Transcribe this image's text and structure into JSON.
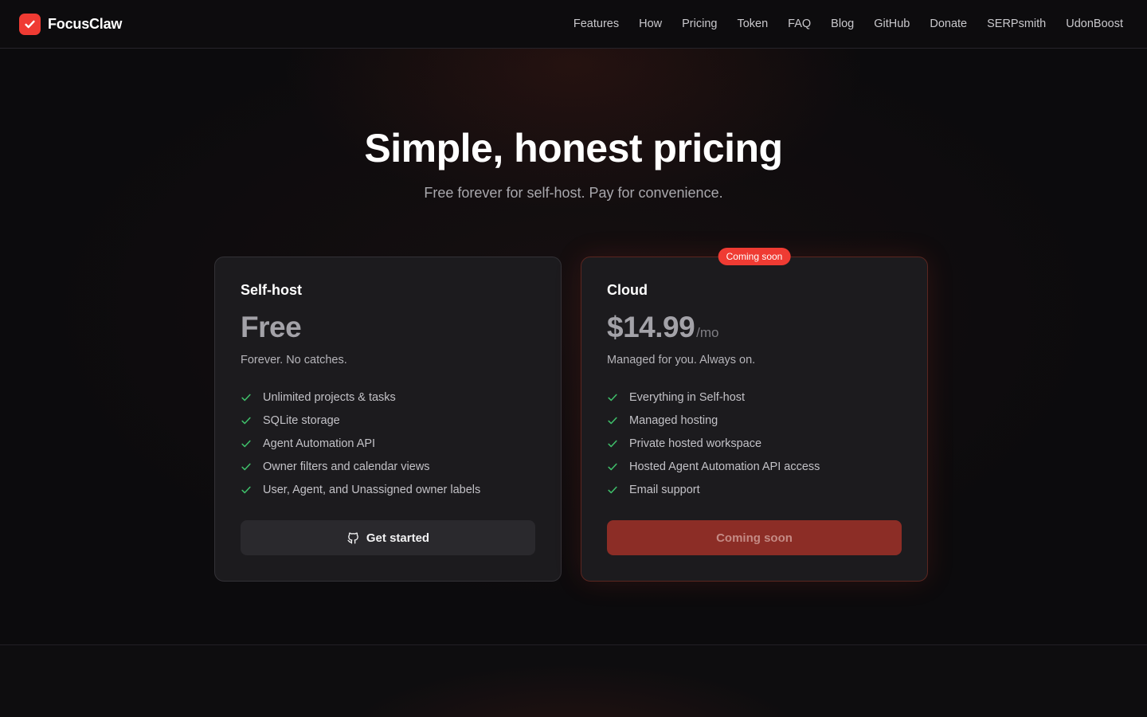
{
  "header": {
    "brand": "FocusClaw",
    "logo_icon": "check-icon",
    "nav": [
      "Features",
      "How",
      "Pricing",
      "Token",
      "FAQ",
      "Blog",
      "GitHub",
      "Donate",
      "SERPsmith",
      "UdonBoost"
    ]
  },
  "hero": {
    "title": "Simple, honest pricing",
    "subtitle": "Free forever for self-host. Pay for convenience."
  },
  "plans": {
    "selfhost": {
      "name": "Self-host",
      "price": "Free",
      "tagline": "Forever. No catches.",
      "features": [
        "Unlimited projects & tasks",
        "SQLite storage",
        "Agent Automation API",
        "Owner filters and calendar views",
        "User, Agent, and Unassigned owner labels"
      ],
      "cta": "Get started",
      "cta_icon": "github-icon"
    },
    "cloud": {
      "badge": "Coming soon",
      "name": "Cloud",
      "price": "$14.99",
      "period": "/mo",
      "tagline": "Managed for you. Always on.",
      "features": [
        "Everything in Self-host",
        "Managed hosting",
        "Private hosted workspace",
        "Hosted Agent Automation API access",
        "Email support"
      ],
      "cta": "Coming soon"
    }
  },
  "colors": {
    "accent": "#ef3b33",
    "check": "#3fbf6a",
    "background": "#0c0b0d",
    "card": "#1c1b1e"
  }
}
